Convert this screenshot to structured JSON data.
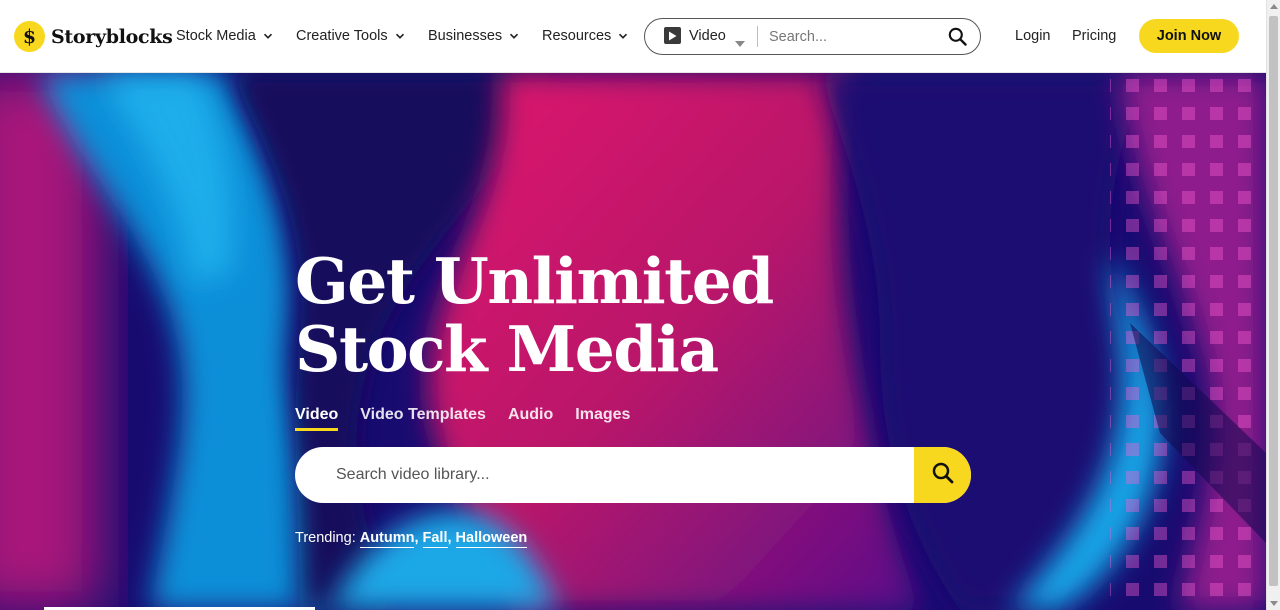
{
  "header": {
    "logo_mark": "$",
    "logo_text": "Storyblocks",
    "nav": [
      {
        "label": "Stock Media"
      },
      {
        "label": "Creative Tools"
      },
      {
        "label": "Businesses"
      },
      {
        "label": "Resources"
      }
    ],
    "search": {
      "type_label": "Video",
      "placeholder": "Search..."
    },
    "login_label": "Login",
    "pricing_label": "Pricing",
    "join_label": "Join Now"
  },
  "hero": {
    "title_line1": "Get Unlimited",
    "title_line2": "Stock Media",
    "tabs": [
      {
        "label": "Video",
        "active": true
      },
      {
        "label": "Video Templates",
        "active": false
      },
      {
        "label": "Audio",
        "active": false
      },
      {
        "label": "Images",
        "active": false
      }
    ],
    "search_placeholder": "Search video library...",
    "trending": {
      "label": "Trending:",
      "terms": [
        "Autumn",
        "Fall",
        "Halloween"
      ],
      "separator": ","
    }
  },
  "colors": {
    "accent": "#f7d81e",
    "hero_deep_blue": "#170a6e",
    "hero_magenta": "#c2186a",
    "hero_cyan": "#12a0e0"
  },
  "icons": [
    "search-icon",
    "play-icon",
    "chevron-down-icon",
    "caret-down-icon"
  ]
}
